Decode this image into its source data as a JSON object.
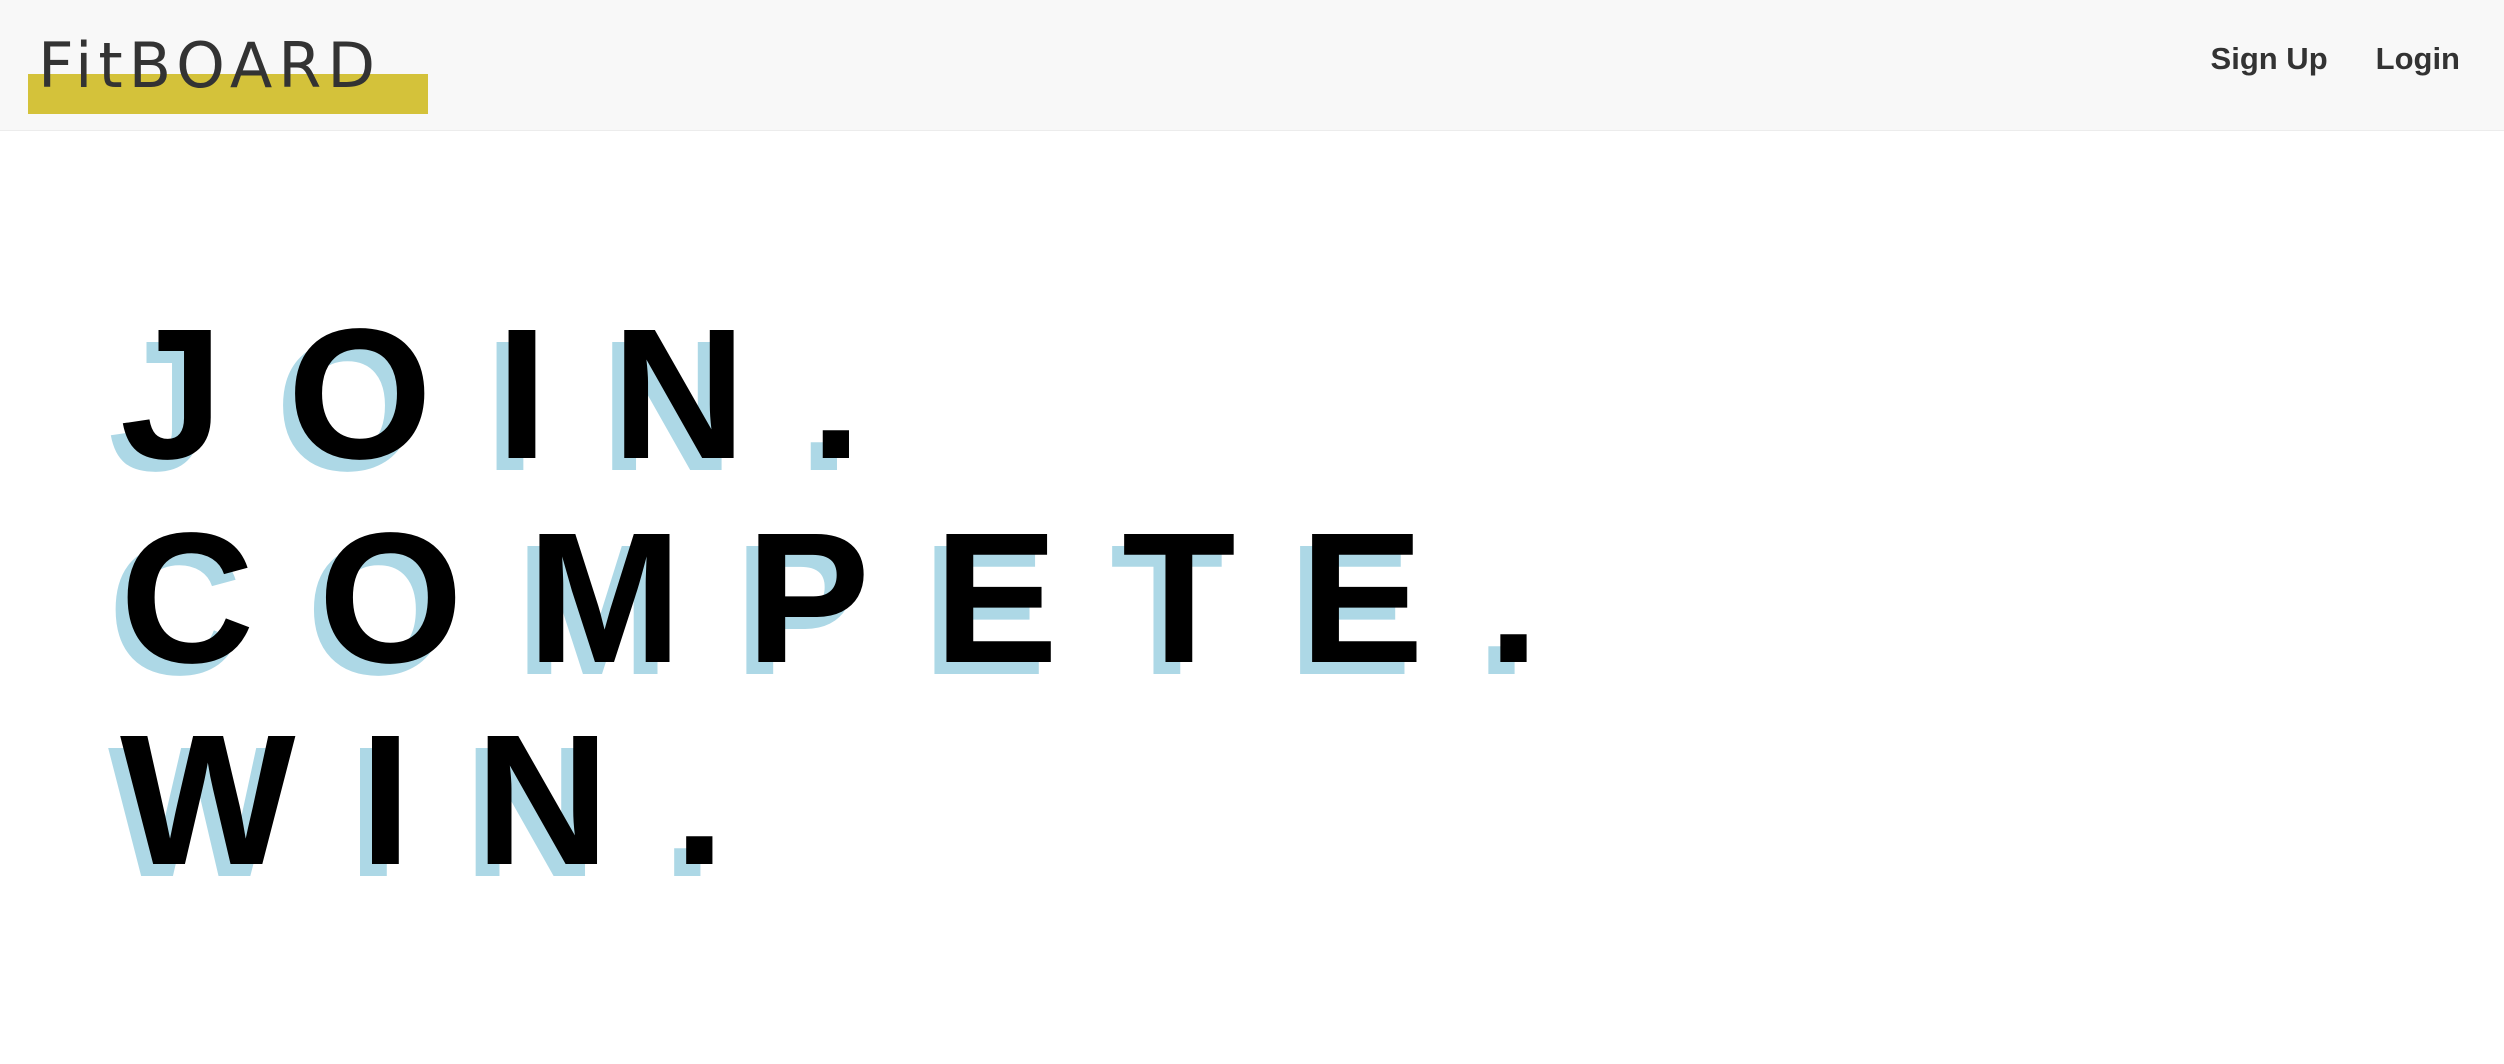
{
  "navbar": {
    "logo_text": "FitBOARD",
    "links": [
      {
        "label": "Sign Up"
      },
      {
        "label": "Login"
      }
    ]
  },
  "hero": {
    "lines": [
      {
        "text": "JOIN."
      },
      {
        "text": "COMPETE."
      },
      {
        "text": "WIN."
      }
    ]
  },
  "colors": {
    "navbar_background": "#f8f8f8",
    "logo_highlight": "#d4c23a",
    "logo_text": "#333333",
    "hero_text": "#000000",
    "hero_shadow": "#add8e6",
    "page_background": "#ffffff"
  }
}
